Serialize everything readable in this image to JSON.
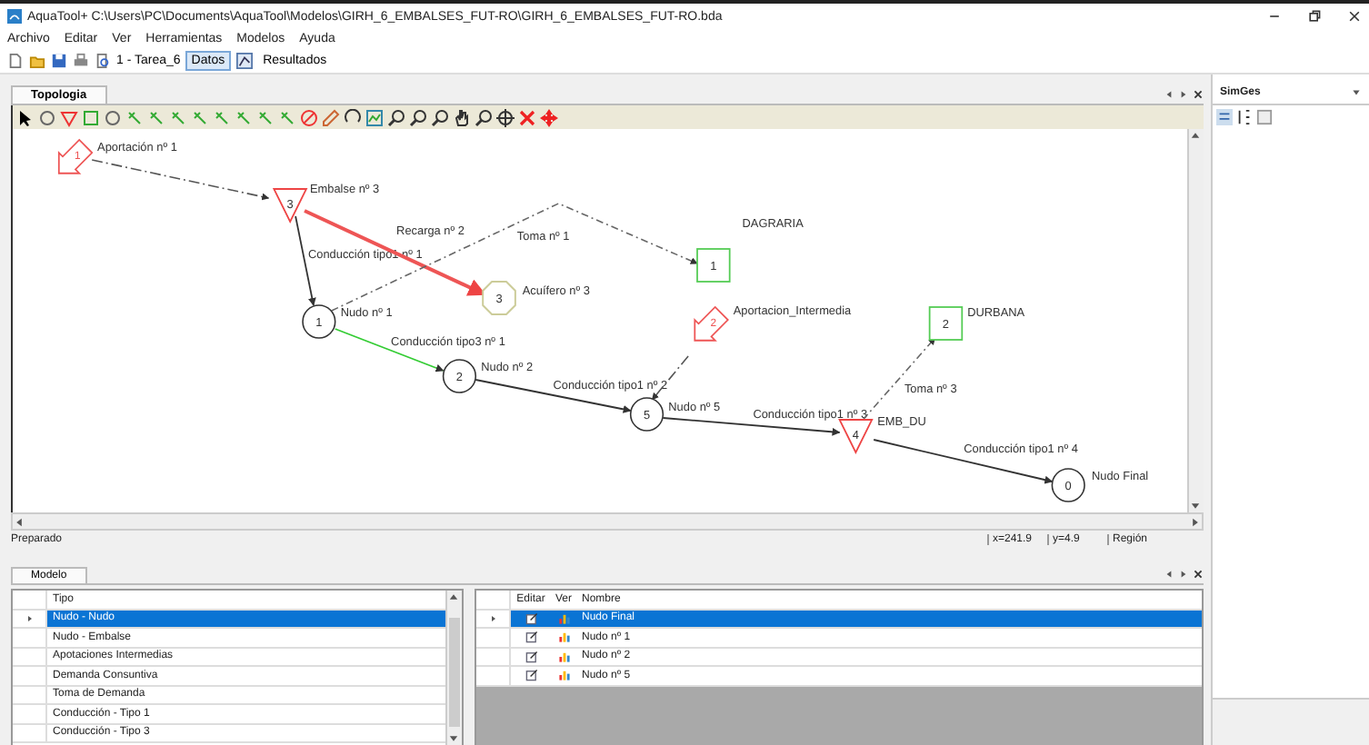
{
  "window": {
    "title": "AquaTool+ C:\\Users\\PC\\Documents\\AquaTool\\Modelos\\GIRH_6_EMBALSES_FUT-RO\\GIRH_6_EMBALSES_FUT-RO.bda"
  },
  "menu": [
    "Archivo",
    "Editar",
    "Ver",
    "Herramientas",
    "Modelos",
    "Ayuda"
  ],
  "toolbar": {
    "task": "1 - Tarea_6",
    "modes": [
      {
        "label": "Datos",
        "selected": true
      },
      {
        "label": "Resultados",
        "selected": false
      }
    ]
  },
  "document_tab": {
    "label": "Topologia"
  },
  "diagram": {
    "nodes": [
      {
        "kind": "inflow",
        "number": "1",
        "label": "Aportación nº 1"
      },
      {
        "kind": "reservoir",
        "number": "3",
        "label": "Embalse nº 3"
      },
      {
        "kind": "node",
        "number": "1",
        "label": "Nudo nº 1"
      },
      {
        "kind": "aquifer",
        "number": "3",
        "label": "Acuífero nº 3"
      },
      {
        "kind": "demand",
        "number": "1",
        "label": "DAGRARIA"
      },
      {
        "kind": "inflow",
        "number": "2",
        "label": "Aportacion_Intermedia"
      },
      {
        "kind": "node",
        "number": "2",
        "label": "Nudo nº 2"
      },
      {
        "kind": "node",
        "number": "5",
        "label": "Nudo nº 5"
      },
      {
        "kind": "demand",
        "number": "2",
        "label": "DURBANA"
      },
      {
        "kind": "reservoir",
        "number": "4",
        "label": "EMB_DU"
      },
      {
        "kind": "node",
        "number": "0",
        "label": "Nudo Final"
      }
    ],
    "edges": [
      {
        "kind": "inflow"
      },
      {
        "kind": "conduction1",
        "label": "Conducción tipo1 nº 1"
      },
      {
        "kind": "recharge",
        "label": "Recarga nº 2"
      },
      {
        "kind": "intake",
        "label": "Toma nº 1"
      },
      {
        "kind": "conduction3",
        "label": "Conducción tipo3 nº 1"
      },
      {
        "kind": "conduction1",
        "label": "Conducción tipo1 nº 2"
      },
      {
        "kind": "inflow"
      },
      {
        "kind": "conduction1",
        "label": "Conducción tipo1 nº 3"
      },
      {
        "kind": "intake",
        "label": "Toma nº 3"
      },
      {
        "kind": "conduction1",
        "label": "Conducción tipo1 nº 4"
      }
    ]
  },
  "status_bar": {
    "message": "Preparado",
    "x": "x=241.9",
    "y": "y=4.9",
    "mode": "Región"
  },
  "bottom_tab": {
    "label": "Modelo"
  },
  "types_table": {
    "column": "Tipo",
    "rows": [
      {
        "name": "Nudo - Nudo",
        "selected": true
      },
      {
        "name": "Nudo - Embalse",
        "selected": false
      },
      {
        "name": "Apotaciones Intermedias",
        "selected": false
      },
      {
        "name": "Demanda Consuntiva",
        "selected": false
      },
      {
        "name": "Toma de Demanda",
        "selected": false
      },
      {
        "name": "Conducción - Tipo 1",
        "selected": false
      },
      {
        "name": "Conducción - Tipo 3",
        "selected": false
      }
    ]
  },
  "items_table": {
    "columns": [
      "Editar",
      "Ver",
      "Nombre"
    ],
    "rows": [
      {
        "name": "Nudo Final",
        "selected": true
      },
      {
        "name": "Nudo nº 1",
        "selected": false
      },
      {
        "name": "Nudo nº 2",
        "selected": false
      },
      {
        "name": "Nudo nº 5",
        "selected": false
      }
    ]
  },
  "side_panel": {
    "title": "SimGes"
  }
}
